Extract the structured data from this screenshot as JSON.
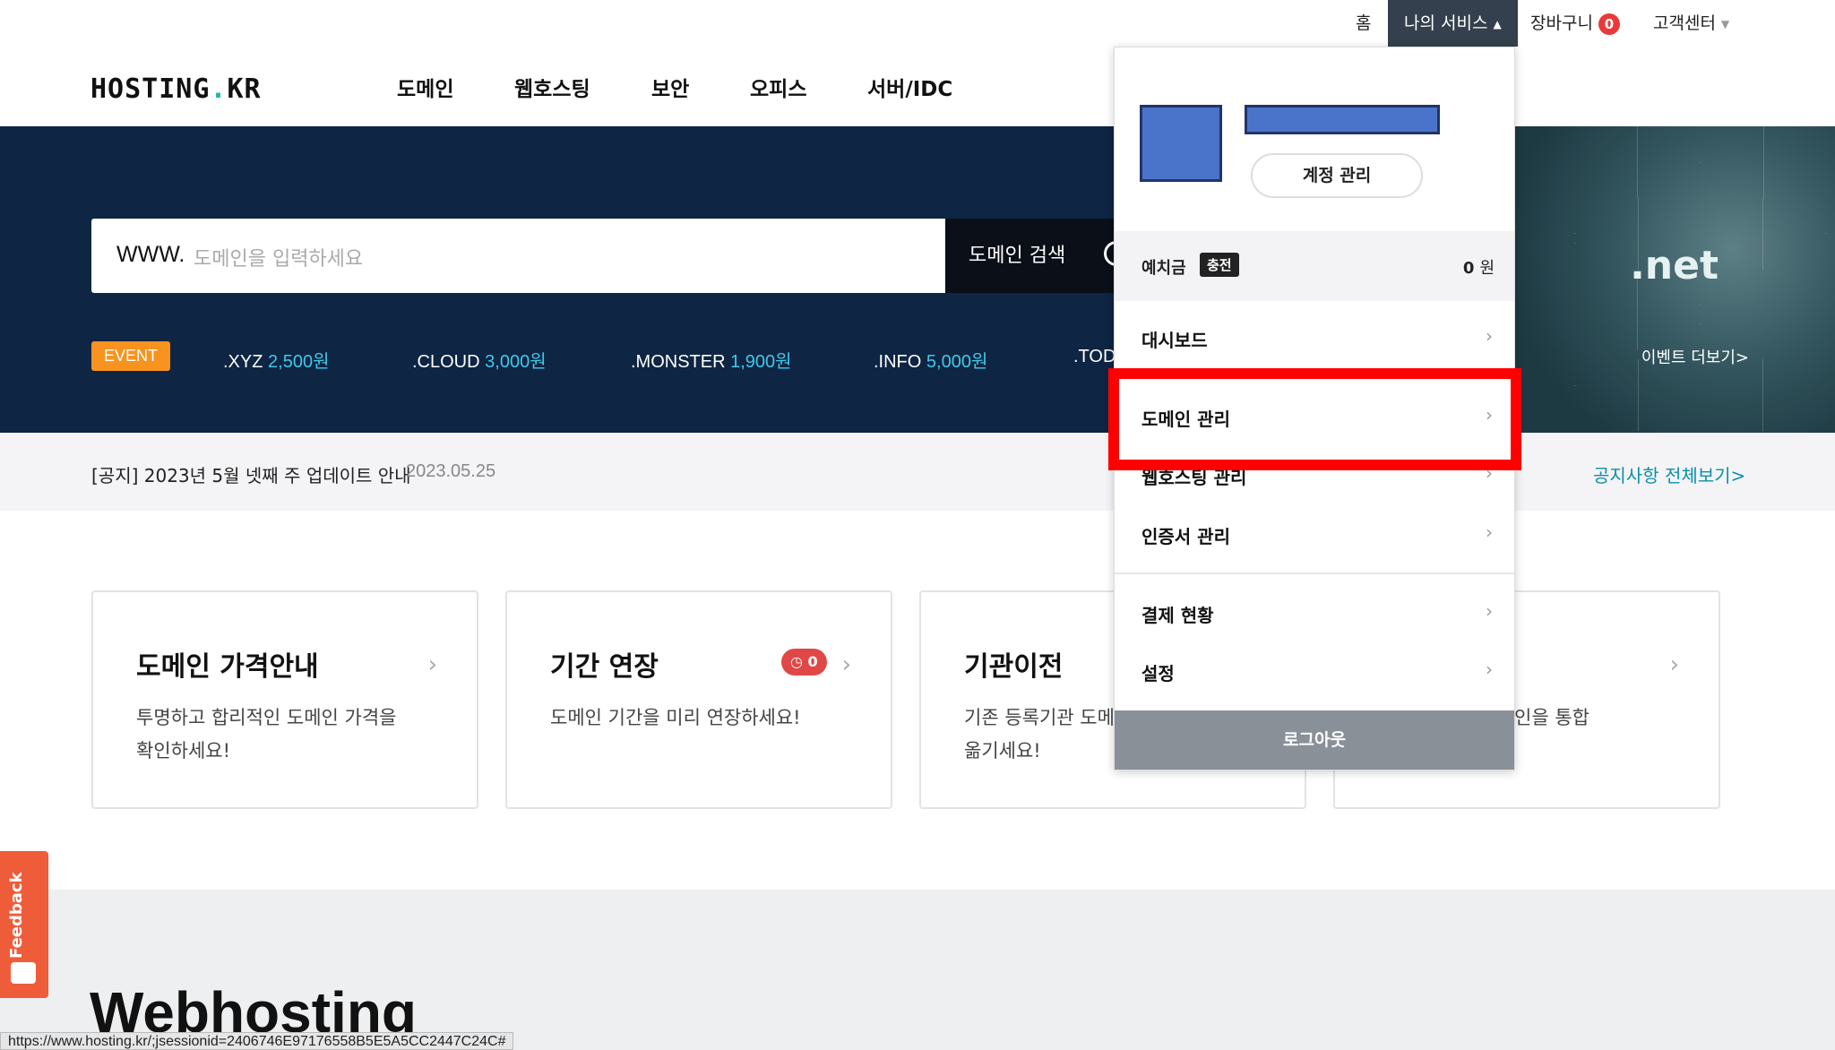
{
  "util": {
    "home": "홈",
    "my_service": "나의 서비스",
    "cart": "장바구니",
    "cart_count": "0",
    "support": "고객센터"
  },
  "logo": {
    "main": "HOSTING",
    "dot": ".",
    "tld": "KR"
  },
  "nav": [
    "도메인",
    "웹호스팅",
    "보안",
    "오피스",
    "서버/IDC"
  ],
  "search": {
    "prefix": "WWW.",
    "placeholder": "도메인을 입력하세요",
    "button": "도메인 검색"
  },
  "event": {
    "badge": "EVENT",
    "tlds": [
      {
        "name": ".XYZ",
        "price": "2,500원"
      },
      {
        "name": ".CLOUD",
        "price": "3,000원"
      },
      {
        "name": ".MONSTER",
        "price": "1,900원"
      },
      {
        "name": ".INFO",
        "price": "5,000원"
      },
      {
        "name": ".TOD",
        "price": ""
      }
    ],
    "banner_text": ".net",
    "more": "이벤트 더보기>"
  },
  "notice": {
    "text": "[공지] 2023년 5월 넷째 주 업데이트 안내",
    "date": "2023.05.25",
    "more": "공지사항 전체보기>"
  },
  "cards": [
    {
      "title": "도메인 가격안내",
      "desc1": "투명하고 합리적인 도메인 가격을",
      "desc2": "확인하세요!"
    },
    {
      "title": "기간 연장",
      "desc1": "도메인 기간을 미리 연장하세요!",
      "desc2": "",
      "badge": "0"
    },
    {
      "title": "기관이전",
      "desc1": "기존 등록기관 도메",
      "desc2": "옮기세요!"
    },
    {
      "title": "",
      "desc1": "인을 통합",
      "desc2": ""
    }
  ],
  "lower": {
    "title": "Webhosting"
  },
  "feedback": "Feedback",
  "status_url": "https://www.hosting.kr/;jsessionid=2406746E97176558B5E5A5CC2447C24C#",
  "dropdown": {
    "account_button": "계정 관리",
    "deposit_label": "예치금",
    "charge": "충전",
    "deposit_amount": "0",
    "deposit_unit": "원",
    "menu": [
      "대시보드",
      "도메인 관리",
      "웹호스팅 관리",
      "인증서 관리",
      "결제 현황",
      "설정"
    ],
    "logout": "로그아웃"
  },
  "colors": {
    "hero_bg": "#0e2543",
    "accent_teal": "#0a8fa8",
    "price_blue": "#41c8e8",
    "event_orange": "#f7931e",
    "highlight_red": "#ff0000"
  }
}
